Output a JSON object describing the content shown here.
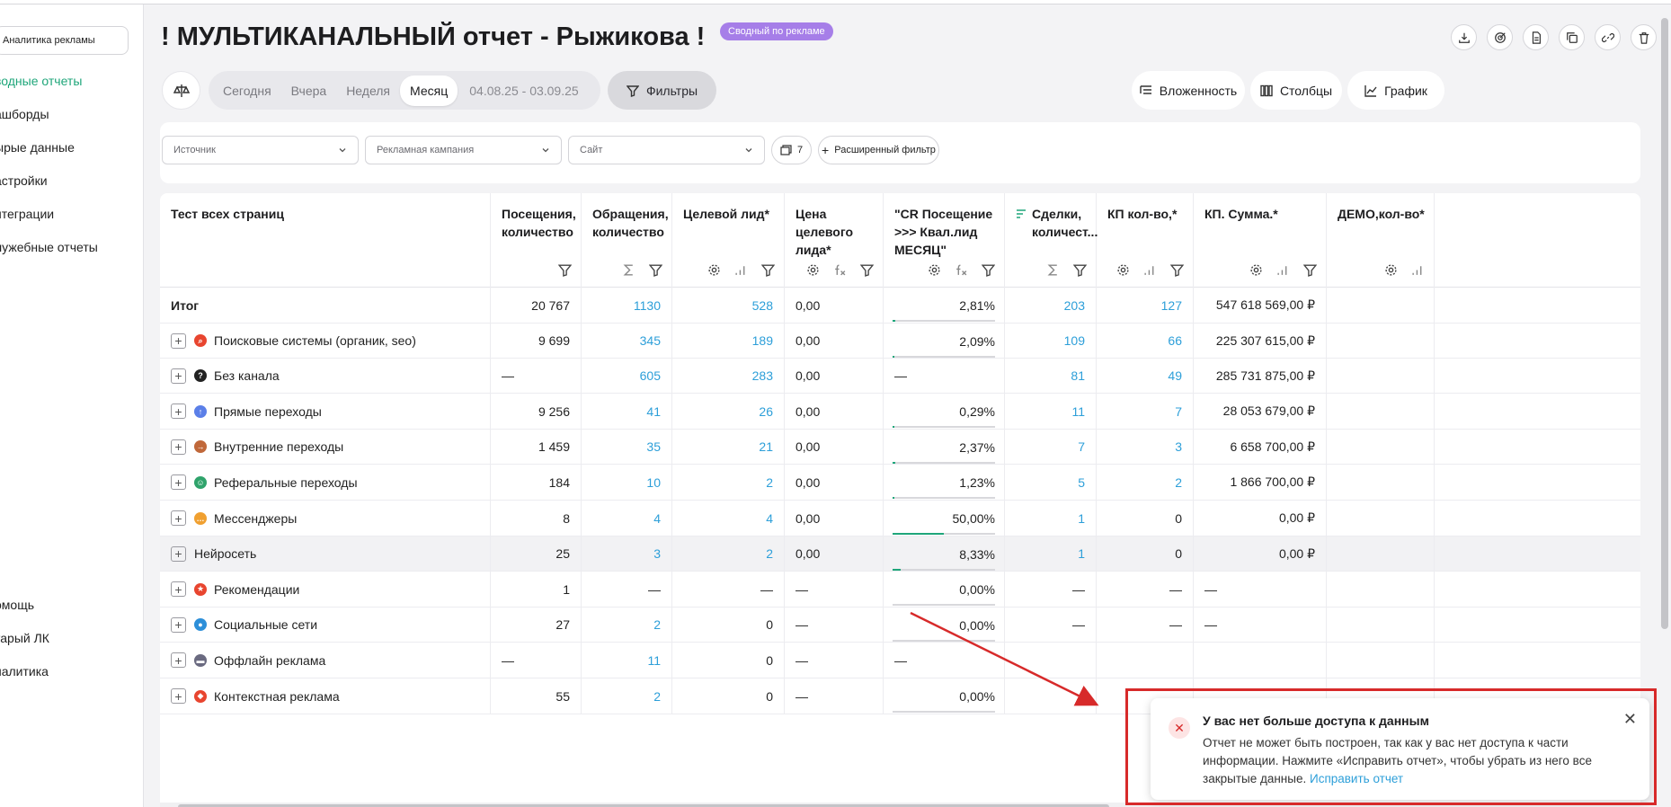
{
  "sidebar": {
    "selector": "Аналитика рекламы",
    "items": [
      "водные отчеты",
      "ашборды",
      "ырые данные",
      "астройки",
      "нтеграции",
      "лужебные отчеты"
    ],
    "bottom_items": [
      "омощь",
      "тарый ЛК",
      "налитика"
    ]
  },
  "header": {
    "title": "! МУЛЬТИКАНАЛЬНЫЙ отчет - Рыжикова !",
    "badge": "Сводный по рекламе",
    "top_icons": [
      "download-icon",
      "target-icon",
      "document-icon",
      "copy-icon",
      "link-icon",
      "trash-icon"
    ]
  },
  "periods": {
    "items": [
      "Сегодня",
      "Вчера",
      "Неделя",
      "Месяц"
    ],
    "active": "Месяц",
    "date_range": "04.08.25 - 03.09.25"
  },
  "toolbar": {
    "filters_label": "Фильтры",
    "nesting_label": "Вложенность",
    "columns_label": "Столбцы",
    "chart_label": "График"
  },
  "filters": {
    "source_placeholder": "Источник",
    "campaign_placeholder": "Рекламная кампания",
    "site_placeholder": "Сайт",
    "count_label": "7",
    "advanced_label": "Расширенный фильтр"
  },
  "table": {
    "columns": [
      "Тест всех страниц",
      "Посещения, количество",
      "Обращения, количество",
      "Целевой лид*",
      "Цена целевого лида*",
      "\"CR Посещение >>> Квал.лид МЕСЯЦ\"",
      "Сделки, количест...",
      "КП кол-во,*",
      "КП. Сумма.*",
      "ДЕМО,кол-во*"
    ],
    "rows": [
      {
        "name": "Итог",
        "visits": "20 767",
        "requests": "1130",
        "leads": "528",
        "price": "0,00",
        "cr": "2,81%",
        "cr_fill": 0.0281,
        "deals": "203",
        "kp": "127",
        "kp_sum": "547 618 569,00 ₽",
        "demo": ""
      },
      {
        "name": "Поисковые системы (органик, seo)",
        "visits": "9 699",
        "requests": "345",
        "leads": "189",
        "price": "0,00",
        "cr": "2,09%",
        "cr_fill": 0.0209,
        "deals": "109",
        "kp": "66",
        "kp_sum": "225 307 615,00 ₽",
        "demo": ""
      },
      {
        "name": "Без канала",
        "visits": "—",
        "requests": "605",
        "leads": "283",
        "price": "0,00",
        "cr": "—",
        "cr_fill": 0,
        "deals": "81",
        "kp": "49",
        "kp_sum": "285 731 875,00 ₽",
        "demo": ""
      },
      {
        "name": "Прямые переходы",
        "visits": "9 256",
        "requests": "41",
        "leads": "26",
        "price": "0,00",
        "cr": "0,29%",
        "cr_fill": 0.0029,
        "deals": "11",
        "kp": "7",
        "kp_sum": "28 053 679,00 ₽",
        "demo": ""
      },
      {
        "name": "Внутренние переходы",
        "visits": "1 459",
        "requests": "35",
        "leads": "21",
        "price": "0,00",
        "cr": "2,37%",
        "cr_fill": 0.0237,
        "deals": "7",
        "kp": "3",
        "kp_sum": "6 658 700,00 ₽",
        "demo": ""
      },
      {
        "name": "Реферальные переходы",
        "visits": "184",
        "requests": "10",
        "leads": "2",
        "price": "0,00",
        "cr": "1,23%",
        "cr_fill": 0.0123,
        "deals": "5",
        "kp": "2",
        "kp_sum": "1 866 700,00 ₽",
        "demo": ""
      },
      {
        "name": "Мессенджеры",
        "visits": "8",
        "requests": "4",
        "leads": "4",
        "price": "0,00",
        "cr": "50,00%",
        "cr_fill": 0.5,
        "deals": "1",
        "kp": "0",
        "kp_sum": "0,00 ₽",
        "demo": ""
      },
      {
        "name": "Нейросеть",
        "visits": "25",
        "requests": "3",
        "leads": "2",
        "price": "0,00",
        "cr": "8,33%",
        "cr_fill": 0.0833,
        "deals": "1",
        "kp": "0",
        "kp_sum": "0,00 ₽",
        "demo": ""
      },
      {
        "name": "Рекомендации",
        "visits": "1",
        "requests": "—",
        "leads": "—",
        "price": "—",
        "cr": "0,00%",
        "cr_fill": 0,
        "deals": "—",
        "kp": "—",
        "kp_sum": "—",
        "demo": ""
      },
      {
        "name": "Социальные сети",
        "visits": "27",
        "requests": "2",
        "leads": "0",
        "price": "—",
        "cr": "0,00%",
        "cr_fill": 0,
        "deals": "—",
        "kp": "—",
        "kp_sum": "—",
        "demo": ""
      },
      {
        "name": "Оффлайн реклама",
        "visits": "—",
        "requests": "11",
        "leads": "0",
        "price": "—",
        "cr": "—",
        "cr_fill": 0,
        "deals": "",
        "kp": "",
        "kp_sum": "",
        "demo": ""
      },
      {
        "name": "Контекстная реклама",
        "visits": "55",
        "requests": "2",
        "leads": "0",
        "price": "—",
        "cr": "0,00%",
        "cr_fill": 0,
        "deals": "",
        "kp": "",
        "kp_sum": "",
        "demo": ""
      }
    ]
  },
  "channel_icons": {
    "Поисковые системы (органик, seo)": {
      "color": "#e8452f",
      "icon": "search-icon"
    },
    "Без канала": {
      "color": "#222222",
      "icon": "question-icon"
    },
    "Прямые переходы": {
      "color": "#5b7fe8",
      "icon": "arrow-up-icon"
    },
    "Внутренние переходы": {
      "color": "#c0683a",
      "icon": "enter-icon"
    },
    "Реферальные переходы": {
      "color": "#2fa36b",
      "icon": "people-icon"
    },
    "Мессенджеры": {
      "color": "#f0a030",
      "icon": "chat-icon"
    },
    "Рекомендации": {
      "color": "#e8452f",
      "icon": "star-icon"
    },
    "Социальные сети": {
      "color": "#2d8fd9",
      "icon": "person-icon"
    },
    "Оффлайн реклама": {
      "color": "#6a6a80",
      "icon": "billboard-icon"
    },
    "Контекстная реклама": {
      "color": "#e8452f",
      "icon": "megaphone-icon"
    }
  },
  "toast": {
    "title": "У вас нет больше доступа к данным",
    "text": "Отчет не может быть построен, так как у вас нет доступа к части информации. Нажмите «Исправить отчет», чтобы убрать из него все закрытые данные.",
    "link": "Исправить отчет"
  },
  "colors": {
    "accent_green": "#1fa67a",
    "link_blue": "#2d9fd9",
    "badge_purple": "#a67ee8",
    "annotation_red": "#d72a2a"
  }
}
